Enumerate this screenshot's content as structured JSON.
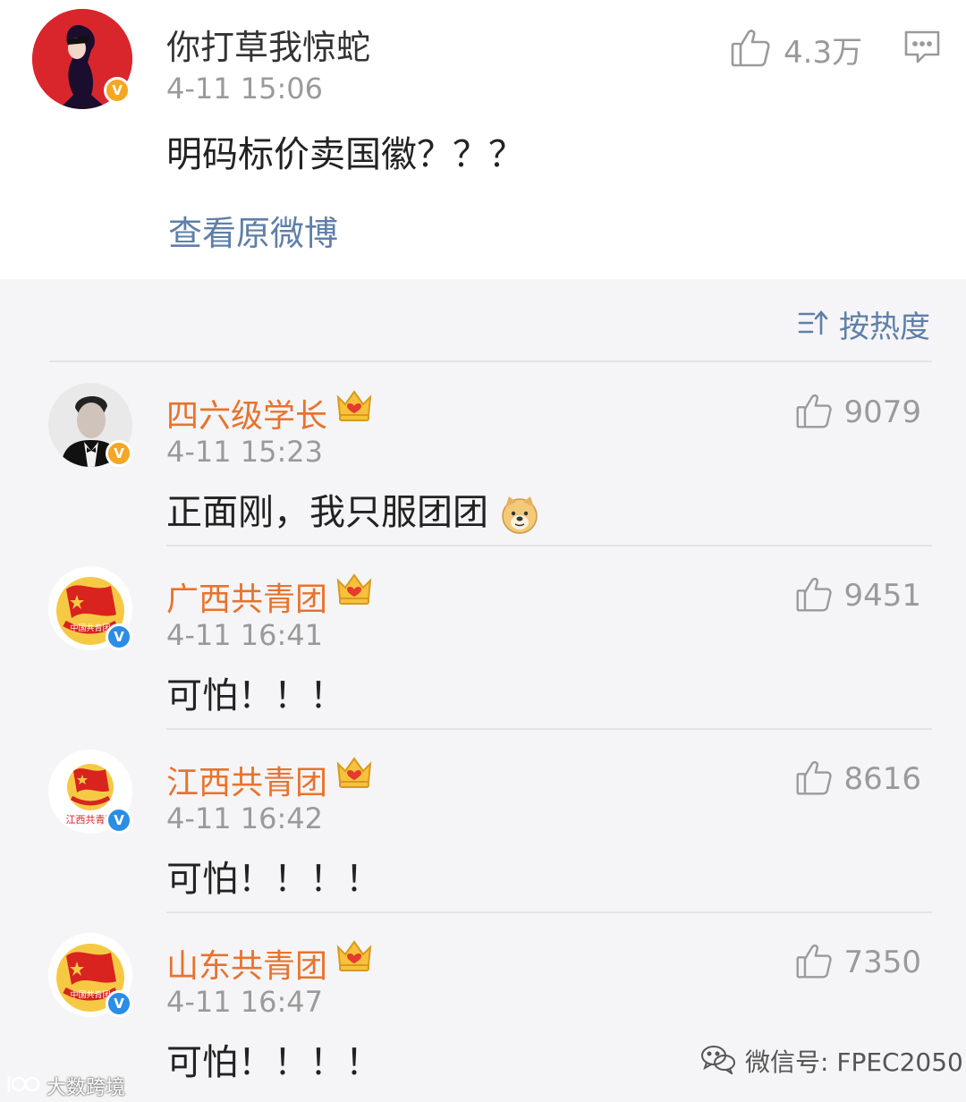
{
  "post": {
    "author": "你打草我惊蛇",
    "time": "4-11 15:06",
    "text": "明码标价卖国徽？？？",
    "like_count": "4.3万",
    "view_original": "查看原微博",
    "badge": "V"
  },
  "sort": {
    "label": "按热度"
  },
  "comments": [
    {
      "name": "四六级学长",
      "time": "4-11 15:23",
      "text": "正面刚，我只服团团",
      "likes": "9079",
      "badge": "V"
    },
    {
      "name": "广西共青团",
      "time": "4-11 16:41",
      "text": "可怕！！！",
      "likes": "9451",
      "badge": "V"
    },
    {
      "name": "江西共青团",
      "time": "4-11 16:42",
      "text": "可怕！！！！",
      "likes": "8616",
      "badge": "V",
      "avatar_caption": "江西共青团"
    },
    {
      "name": "山东共青团",
      "time": "4-11 16:47",
      "text": "可怕！！！！",
      "likes": "7350",
      "badge": "V"
    }
  ],
  "emblem_text": "中国共青团",
  "watermark": {
    "right": "微信号: FPEC2050",
    "left": "大数跨境"
  },
  "colors": {
    "name_orange": "#e8732d",
    "link_blue": "#5f7fa8",
    "badge_gold": "#f5a623",
    "badge_blue": "#2b8de6"
  }
}
